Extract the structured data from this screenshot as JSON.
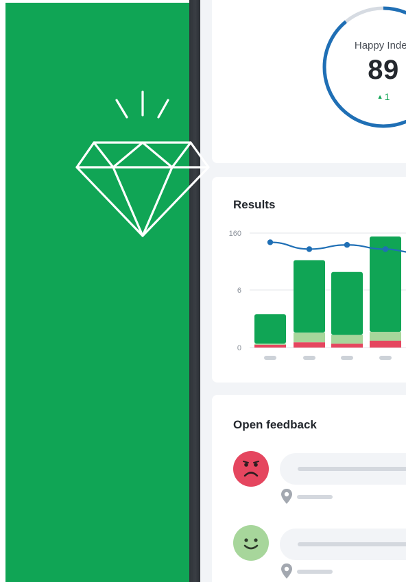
{
  "happy_index": {
    "label": "Happy Index",
    "value": "89",
    "delta": "1",
    "ring_fraction": 0.89
  },
  "results": {
    "title": "Results"
  },
  "feedback": {
    "title": "Open feedback",
    "items": [
      {
        "mood": "sad",
        "icon": "sad-face-icon"
      },
      {
        "mood": "happy",
        "icon": "happy-face-icon"
      }
    ]
  },
  "chart_data": {
    "type": "bar",
    "title": "Results",
    "categories": [
      "",
      "",
      "",
      ""
    ],
    "yticks": [
      "160",
      "6",
      "0"
    ],
    "series": [
      {
        "values": [
          1.5,
          2.8,
          2.0,
          3.6
        ]
      },
      {
        "values": [
          0.5,
          5.0,
          4.6,
          4.6
        ]
      },
      {
        "values": [
          15.5,
          38.0,
          33.0,
          50.0
        ]
      }
    ],
    "line": [
      150,
      121,
      139,
      121
    ],
    "colors": {
      "negative": "#E5465F",
      "neutral": "#A7D69B",
      "positive": "#10A555",
      "line": "#1F6FB5",
      "ring": "#1F6FB5",
      "ring_track": "#D6DBE2"
    }
  }
}
